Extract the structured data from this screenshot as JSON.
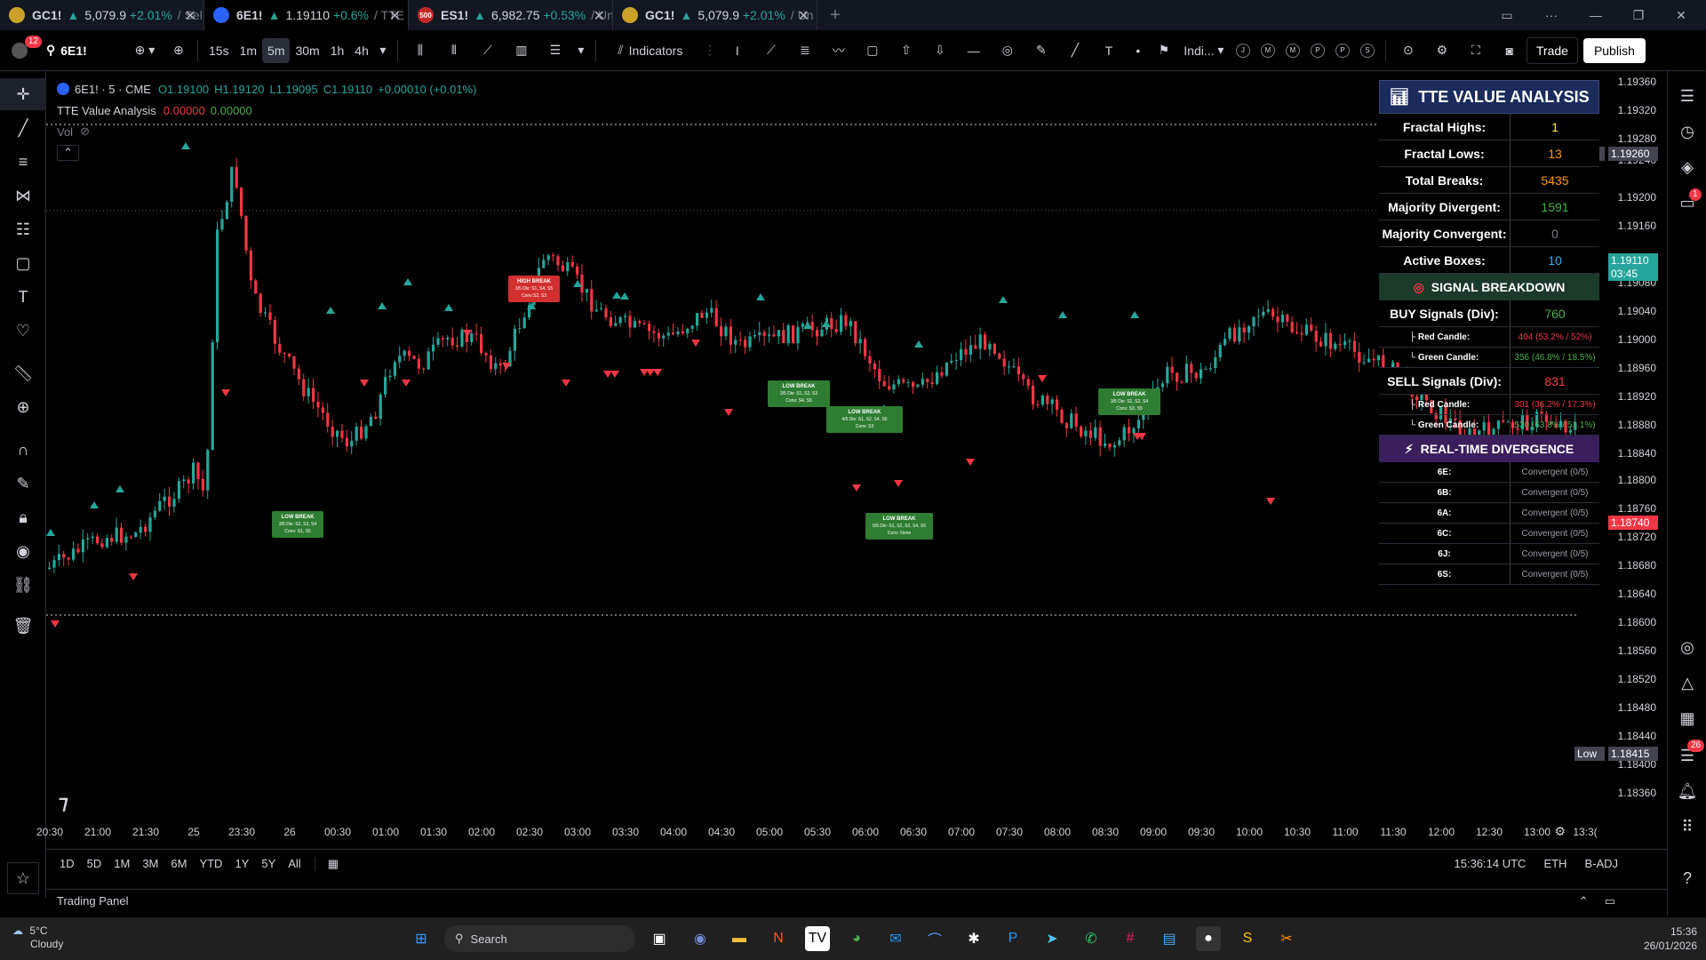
{
  "tabs": [
    {
      "symbol": "GC1!",
      "price": "5,079.9",
      "change": "+2.01%",
      "rest": "/ Sel",
      "icon_color": "#c9a227",
      "active": false
    },
    {
      "symbol": "6E1!",
      "price": "1.19110",
      "change": "+0.6%",
      "rest": "/ TTE",
      "icon_color": "#2962ff",
      "active": true
    },
    {
      "symbol": "ES1!",
      "price": "6,982.75",
      "change": "+0.53%",
      "rest": "/ Un",
      "icon_color": "#c62828",
      "icon_text": "500",
      "active": false
    },
    {
      "symbol": "GC1!",
      "price": "5,079.9",
      "change": "+2.01%",
      "rest": "/ Un",
      "icon_color": "#c9a227",
      "active": false
    }
  ],
  "toolbar": {
    "notif_count": "12",
    "symbol": "6E1!",
    "intervals": [
      "15s",
      "1m",
      "5m",
      "30m",
      "1h",
      "4h"
    ],
    "selected_interval": "5m",
    "indicators_label": "Indicators",
    "indi_label": "Indi...",
    "circle_buttons": [
      "J",
      "M",
      "M",
      "P",
      "P",
      "S"
    ],
    "trade_label": "Trade",
    "publish_label": "Publish"
  },
  "legend": {
    "symbol_line": "6E1! · 5 · CME",
    "o": "O1.19100",
    "h": "H1.19120",
    "l": "L1.19095",
    "c": "C1.19110",
    "chg": "+0.00010 (+0.01%)",
    "indicator": "TTE Value Analysis",
    "ind_v1": "0.00000",
    "ind_v2": "0.00000",
    "vol": "Vol"
  },
  "price_axis": {
    "labels": [
      "1.19360",
      "1.19320",
      "1.19280",
      "1.19240",
      "1.19200",
      "1.19160",
      "1.19080",
      "1.19040",
      "1.19000",
      "1.18960",
      "1.18920",
      "1.18880",
      "1.18840",
      "1.18800",
      "1.18760",
      "1.18720",
      "1.18680",
      "1.18640",
      "1.18600",
      "1.18560",
      "1.18520",
      "1.18480",
      "1.18440",
      "1.18400",
      "1.18360"
    ],
    "high_tag": "High",
    "high_value": "1.19260",
    "current_value": "1.19110",
    "current_timer": "03:45",
    "mark_value": "1.18740",
    "low_tag": "Low",
    "low_value": "1.18415"
  },
  "x_axis": [
    "20:30",
    "21:00",
    "21:30",
    "25",
    "23:30",
    "26",
    "00:30",
    "01:00",
    "01:30",
    "02:00",
    "02:30",
    "03:00",
    "03:30",
    "04:00",
    "04:30",
    "05:00",
    "05:30",
    "06:00",
    "06:30",
    "07:00",
    "07:30",
    "08:00",
    "08:30",
    "09:00",
    "09:30",
    "10:00",
    "10:30",
    "11:00",
    "11:30",
    "12:00",
    "12:30",
    "13:00",
    "13:3("
  ],
  "tte": {
    "title": "TTE VALUE ANALYSIS",
    "rows": [
      {
        "k": "Fractal Highs:",
        "v": "1",
        "color": "#ffeb3b"
      },
      {
        "k": "Fractal Lows:",
        "v": "13",
        "color": "#ff9800"
      },
      {
        "k": "Total Breaks:",
        "v": "5435",
        "color": "#ff9800"
      },
      {
        "k": "Majority Divergent:",
        "v": "1591",
        "color": "#4caf50"
      },
      {
        "k": "Majority Convergent:",
        "v": "0",
        "color": "#787b86"
      },
      {
        "k": "Active Boxes:",
        "v": "10",
        "color": "#29b6f6"
      }
    ],
    "signal_title": "SIGNAL BREAKDOWN",
    "buy": {
      "k": "BUY Signals (Div):",
      "v": "760",
      "color": "#4caf50"
    },
    "buy_sub": [
      {
        "k": "├ Red Candle:",
        "v": "404 (53.2% / 52%)",
        "color": "#f23645"
      },
      {
        "k": "└ Green Candle:",
        "v": "356 (46.8% / 18.5%)",
        "color": "#4caf50"
      }
    ],
    "sell": {
      "k": "SELL Signals (Div):",
      "v": "831",
      "color": "#f23645"
    },
    "sell_sub": [
      {
        "k": "├ Red Candle:",
        "v": "301 (36.2% / 17.3%)",
        "color": "#f23645"
      },
      {
        "k": "└ Green Candle:",
        "v": "530 (63.8% / 51.1%)",
        "color": "#4caf50"
      }
    ],
    "rt_title": "REAL-TIME DIVERGENCE",
    "rt_rows": [
      {
        "k": "6E:",
        "v": "Convergent (0/5)"
      },
      {
        "k": "6B:",
        "v": "Convergent (0/5)"
      },
      {
        "k": "6A:",
        "v": "Convergent (0/5)"
      },
      {
        "k": "6C:",
        "v": "Convergent (0/5)"
      },
      {
        "k": "6J:",
        "v": "Convergent (0/5)"
      },
      {
        "k": "6S:",
        "v": "Convergent (0/5)"
      }
    ]
  },
  "chart_labels": [
    {
      "title": "HIGH BREAK",
      "l1": "3/5 Div: S1, S4, S5",
      "l2": "Conv:S2, S3",
      "color": "#d32f2f"
    },
    {
      "title": "LOW BREAK",
      "l1": "3/5 Div: S2, S3, S4",
      "l2": "Conv: S1, S5",
      "color": "#2e7d32"
    },
    {
      "title": "LOW BREAK",
      "l1": "3/5 Div: S1, S2, S3",
      "l2": "Conv: S4, S5",
      "color": "#2e7d32"
    },
    {
      "title": "LOW BREAK",
      "l1": "4/5 Div: S1, S2, S4, S5",
      "l2": "Conv: S3",
      "color": "#2e7d32"
    },
    {
      "title": "LOW BREAK",
      "l1": "5/5 Div: S1, S2, S3, S4, S5",
      "l2": "Conv: None",
      "color": "#2e7d32"
    },
    {
      "title": "LOW BREAK",
      "l1": "3/5 Div: S1, S2, S4",
      "l2": "Conv: S3, S5",
      "color": "#2e7d32"
    }
  ],
  "range_bar": {
    "ranges": [
      "1D",
      "5D",
      "1M",
      "3M",
      "6M",
      "YTD",
      "1Y",
      "5Y",
      "All"
    ],
    "time": "15:36:14 UTC",
    "session": "ETH",
    "adj": "B-ADJ"
  },
  "trading_panel": "Trading Panel",
  "taskbar": {
    "weather_temp": "5°C",
    "weather_desc": "Cloudy",
    "search": "Search",
    "clock": "15:36",
    "date": "26/01/2026"
  },
  "right_badges": {
    "chat": "1",
    "feed": "26"
  },
  "colors": {
    "up": "#26a69a",
    "down": "#f23645",
    "bg": "#000000"
  }
}
